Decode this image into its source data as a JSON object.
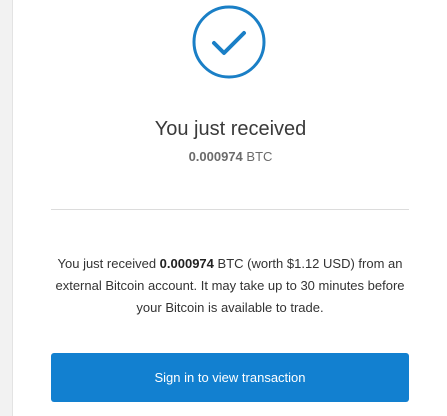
{
  "icon": {
    "name": "checkmark-circle-icon",
    "color": "#1a7fc6"
  },
  "headline": "You just received",
  "amount_summary": {
    "amount": "0.000974",
    "currency": "BTC"
  },
  "message": {
    "prefix": "You just received",
    "amount": "0.000974",
    "suffix": "BTC (worth $1.12 USD) from an external Bitcoin account. It may take up to 30 minutes before your Bitcoin is available to trade."
  },
  "button": {
    "label": "Sign in to view transaction",
    "color": "#1280d0"
  }
}
